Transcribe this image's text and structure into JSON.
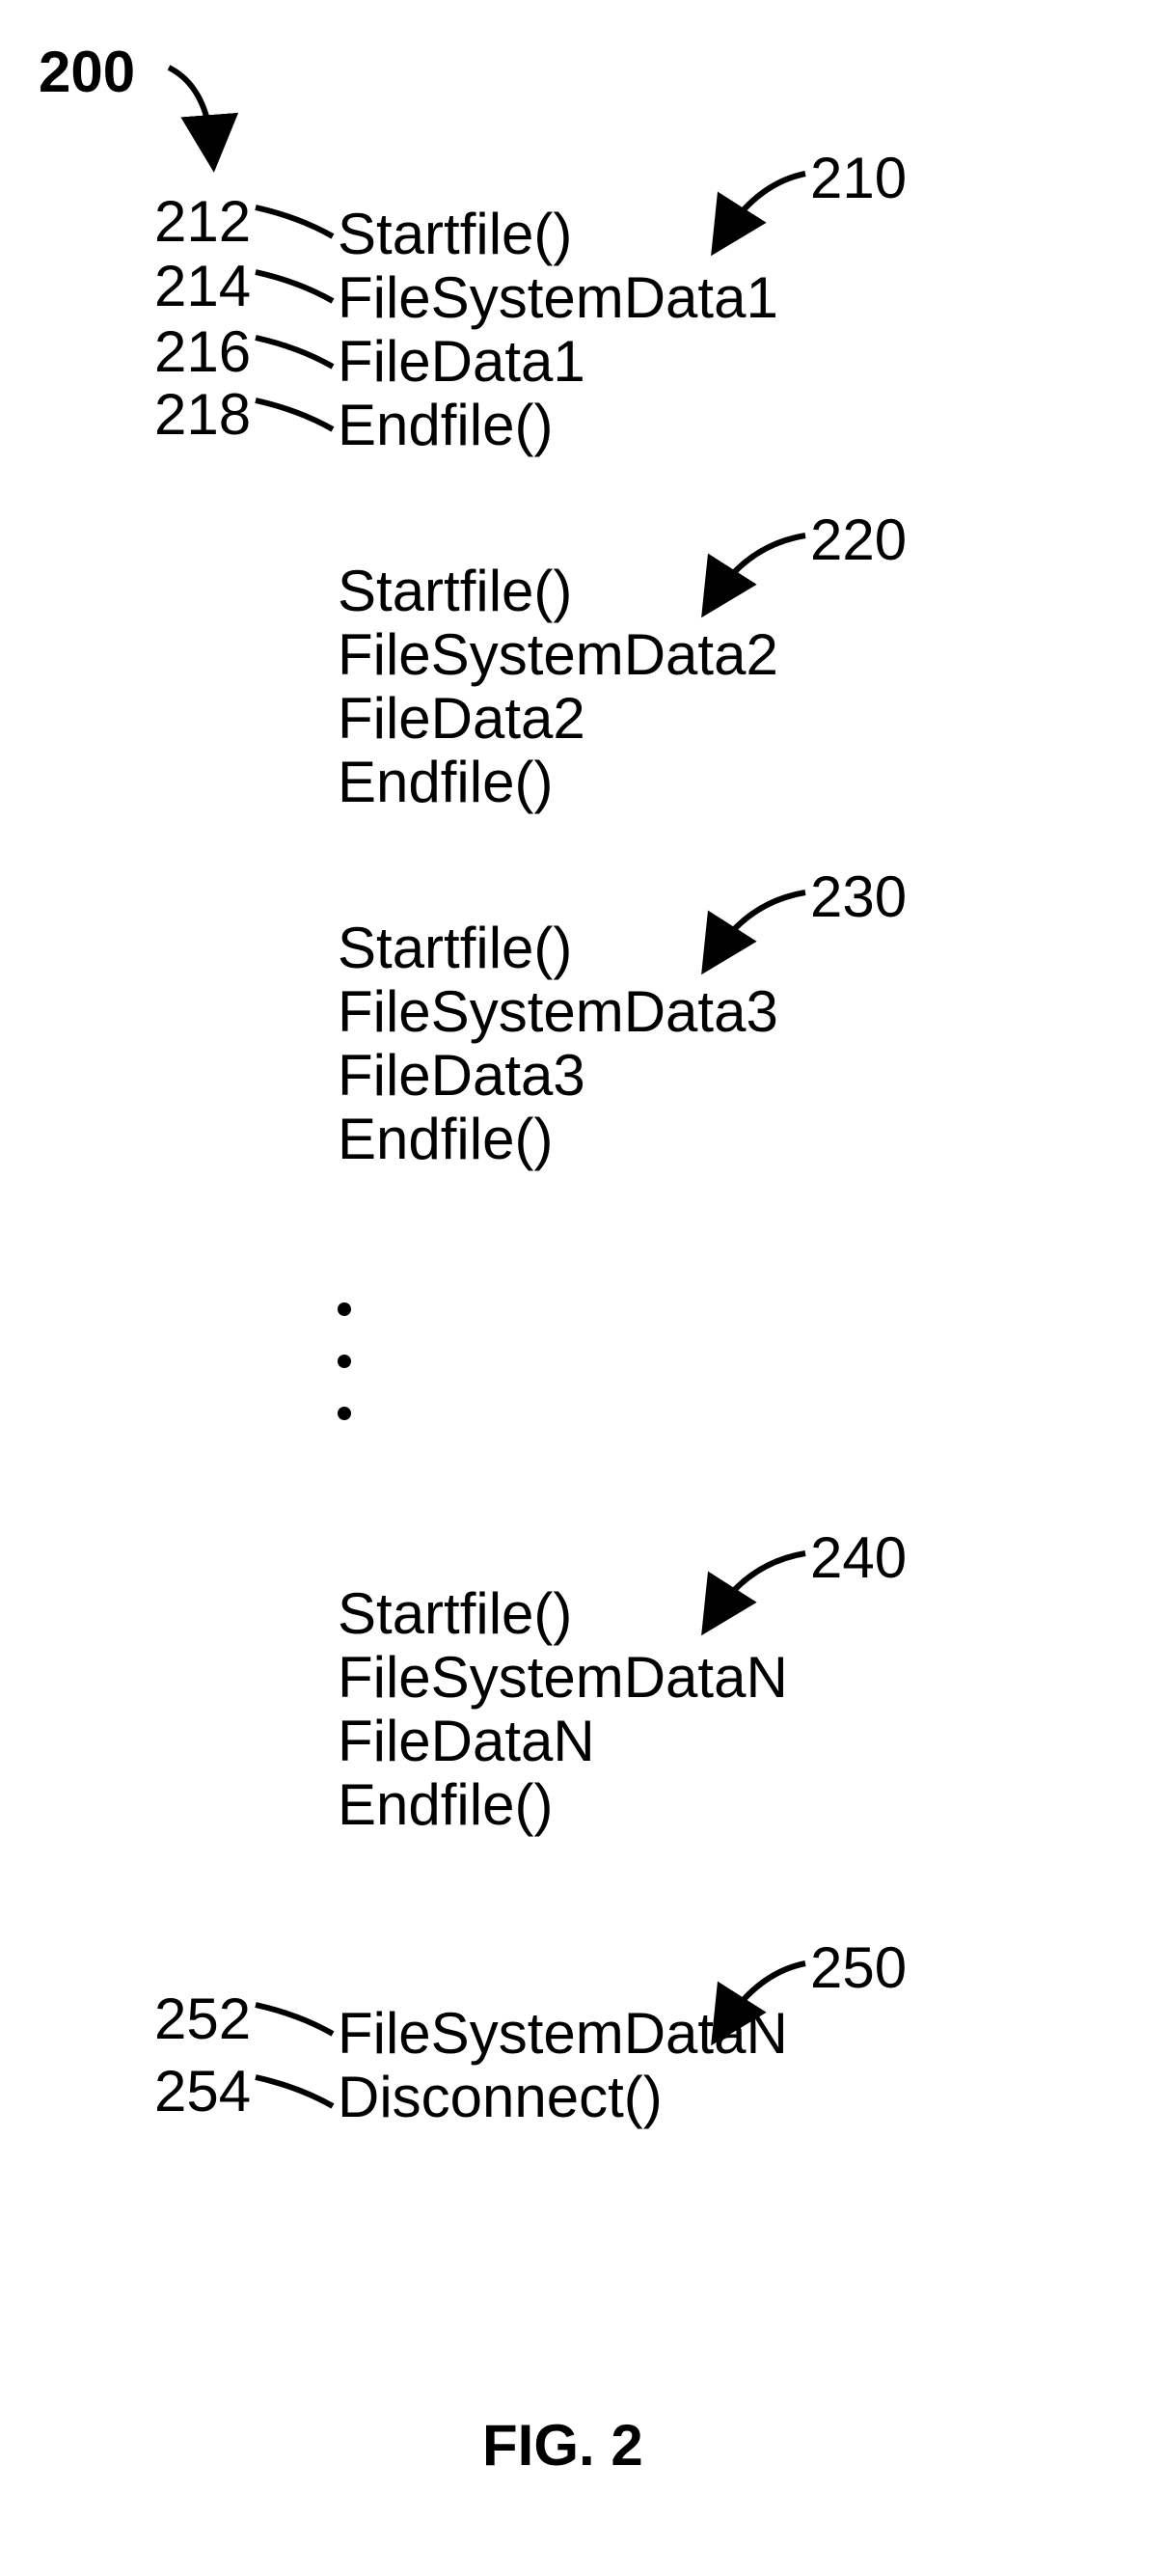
{
  "figure": {
    "number_label": "200",
    "caption": "FIG. 2"
  },
  "refs": {
    "r210": "210",
    "r212": "212",
    "r214": "214",
    "r216": "216",
    "r218": "218",
    "r220": "220",
    "r230": "230",
    "r240": "240",
    "r250": "250",
    "r252": "252",
    "r254": "254"
  },
  "blocks": {
    "b210": {
      "l1": "Startfile()",
      "l2": "FileSystemData1",
      "l3": "FileData1",
      "l4": "Endfile()"
    },
    "b220": {
      "l1": "Startfile()",
      "l2": "FileSystemData2",
      "l3": "FileData2",
      "l4": "Endfile()"
    },
    "b230": {
      "l1": "Startfile()",
      "l2": "FileSystemData3",
      "l3": "FileData3",
      "l4": "Endfile()"
    },
    "b240": {
      "l1": "Startfile()",
      "l2": "FileSystemDataN",
      "l3": "FileDataN",
      "l4": "Endfile()"
    },
    "b250": {
      "l1": "FileSystemDataN",
      "l2": "Disconnect()"
    }
  }
}
